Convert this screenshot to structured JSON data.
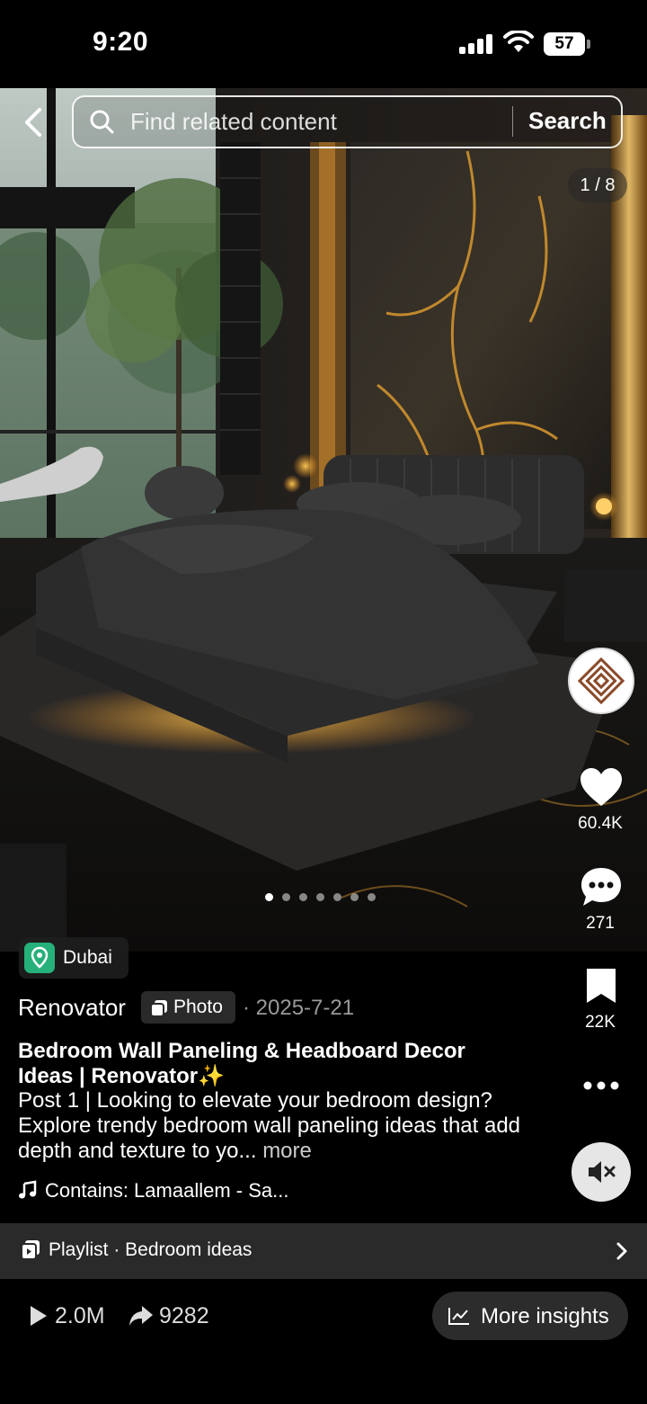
{
  "status_bar": {
    "time": "9:20",
    "battery": "57"
  },
  "search": {
    "placeholder": "Find related content",
    "button_label": "Search"
  },
  "photo": {
    "counter": "1 / 8",
    "total_dots": 7,
    "active_dot": 1
  },
  "rail": {
    "likes": "60.4K",
    "comments": "271",
    "saves": "22K"
  },
  "post": {
    "location": "Dubai",
    "author": "Renovator",
    "type": "Photo",
    "date": "· 2025-7-21",
    "title": "Bedroom Wall Paneling & Headboard Decor Ideas | Renovator✨",
    "description": "Post 1 | Looking to elevate your bedroom design? Explore trendy bedroom wall paneling ideas that add depth and texture to yo...",
    "more_label": "more",
    "music": "Contains: Lamaallem - Sa..."
  },
  "playlist": {
    "label": "Playlist · Bedroom ideas"
  },
  "stats": {
    "plays": "2.0M",
    "shares": "9282",
    "insights_label": "More insights"
  },
  "colors": {
    "accent_green": "#26b07a",
    "gold": "#e8a53a",
    "brand_brown": "#8a4a2a"
  }
}
